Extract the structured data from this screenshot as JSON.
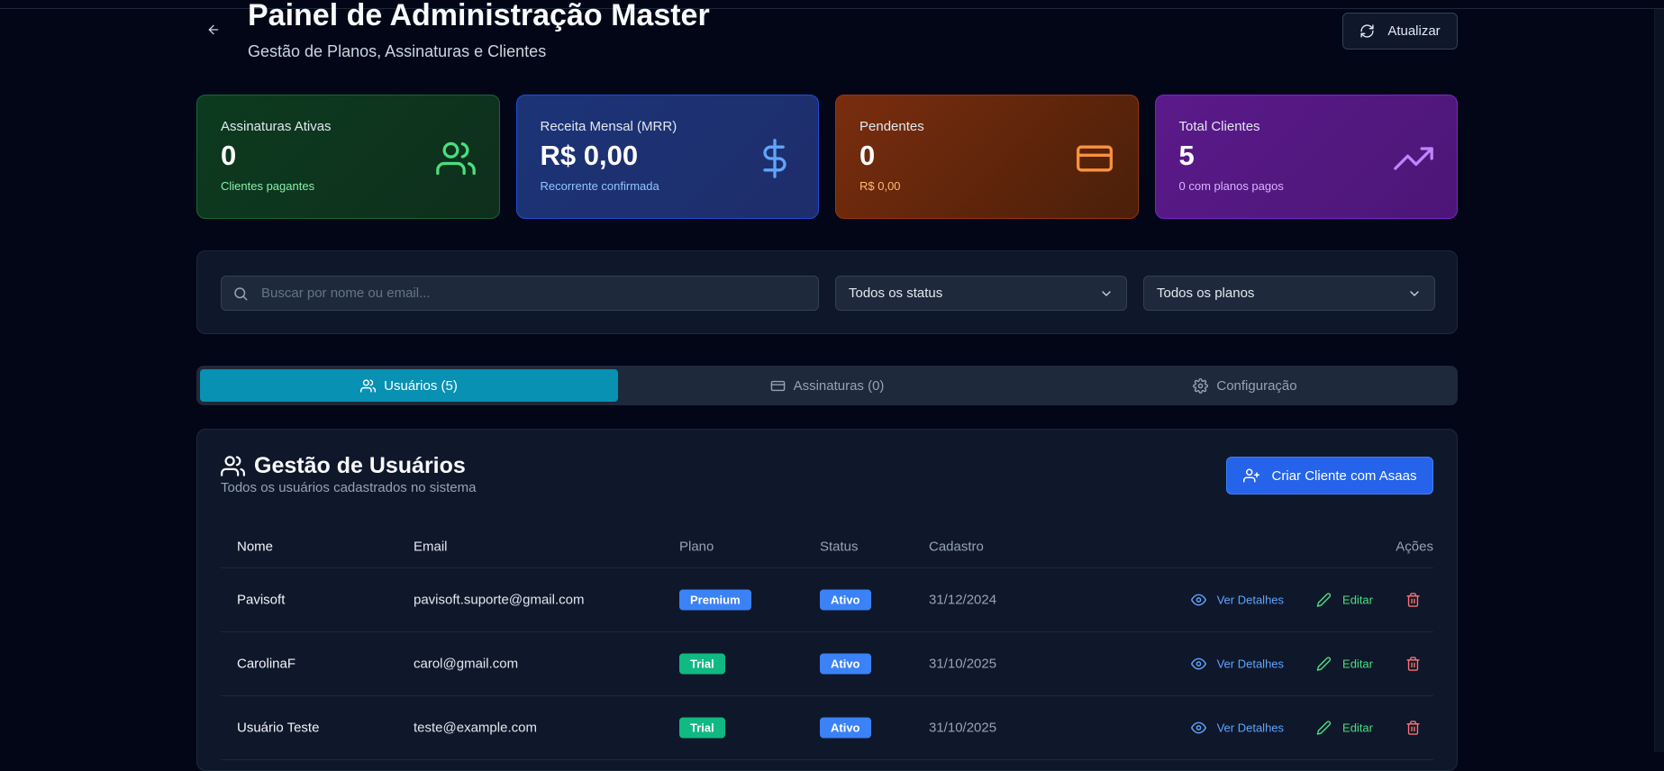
{
  "header": {
    "title": "Painel de Administração Master",
    "subtitle": "Gestão de Planos, Assinaturas e Clientes",
    "refresh_label": "Atualizar"
  },
  "stats": [
    {
      "label": "Assinaturas Ativas",
      "value": "0",
      "hint": "Clientes pagantes",
      "icon": "users-icon",
      "color": "#4ade80"
    },
    {
      "label": "Receita Mensal (MRR)",
      "value": "R$ 0,00",
      "hint": "Recorrente confirmada",
      "icon": "dollar-icon",
      "color": "#60a5fa"
    },
    {
      "label": "Pendentes",
      "value": "0",
      "hint": "R$ 0,00",
      "icon": "credit-card-icon",
      "color": "#fb923c"
    },
    {
      "label": "Total Clientes",
      "value": "5",
      "hint": "0 com planos pagos",
      "icon": "trending-up-icon",
      "color": "#c084fc"
    }
  ],
  "filters": {
    "search_placeholder": "Buscar por nome ou email...",
    "status_selected": "Todos os status",
    "plan_selected": "Todos os planos"
  },
  "tabs": [
    {
      "label": "Usuários (5)",
      "active": true
    },
    {
      "label": "Assinaturas (0)",
      "active": false
    },
    {
      "label": "Configuração",
      "active": false
    }
  ],
  "users_panel": {
    "title": "Gestão de Usuários",
    "subtitle": "Todos os usuários cadastrados no sistema",
    "create_label": "Criar Cliente com Asaas",
    "columns": [
      "Nome",
      "Email",
      "Plano",
      "Status",
      "Cadastro",
      "Ações"
    ],
    "view_label": "Ver Detalhes",
    "edit_label": "Editar",
    "rows": [
      {
        "name": "Pavisoft",
        "email": "pavisoft.suporte@gmail.com",
        "plan": "Premium",
        "status": "Ativo",
        "date": "31/12/2024"
      },
      {
        "name": "CarolinaF",
        "email": "carol@gmail.com",
        "plan": "Trial",
        "status": "Ativo",
        "date": "31/10/2025"
      },
      {
        "name": "Usuário Teste",
        "email": "teste@example.com",
        "plan": "Trial",
        "status": "Ativo",
        "date": "31/10/2025"
      }
    ]
  }
}
